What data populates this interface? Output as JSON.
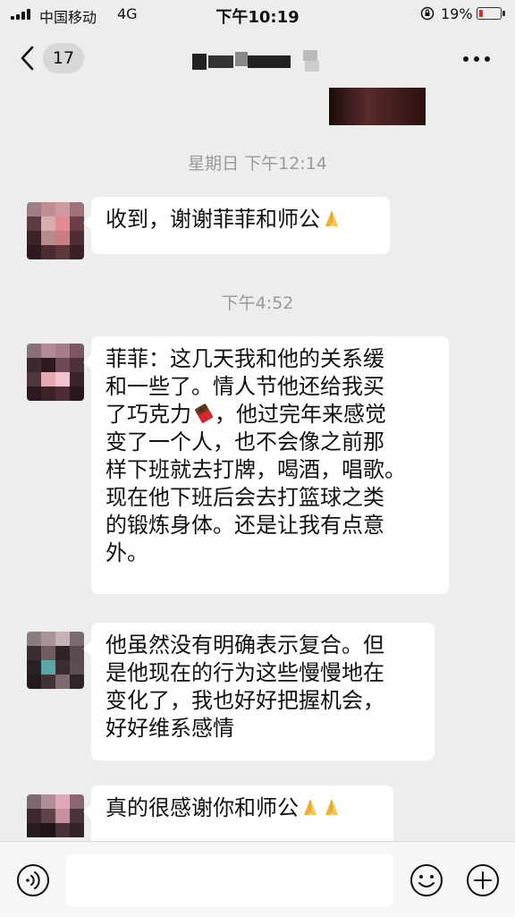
{
  "status_bar": {
    "carrier": "中国移动",
    "network": "4G",
    "time": "下午10:19",
    "battery": "19%",
    "battery_level": 0.19
  },
  "nav": {
    "unread_count": "17"
  },
  "messages": [
    {
      "type": "timestamp",
      "text": "星期日 下午12:14"
    },
    {
      "type": "incoming",
      "lines": [
        "收到，谢谢菲菲和师公"
      ],
      "trailing_emoji": [
        "folded-hands"
      ]
    },
    {
      "type": "timestamp",
      "text": "下午4:52"
    },
    {
      "type": "incoming",
      "lines": [
        "菲菲：这几天我和他的关系缓",
        "和一些了。情人节他还给我买",
        "了巧克力",
        "变了一个人，也不会像之前那",
        "样下班就去打牌，喝酒，唱歌。",
        "现在他下班后会去打篮球之类",
        "的锻炼身体。还是让我有点意",
        "外。"
      ],
      "inline_emoji": "chocolate",
      "line3_tail": "，他过完年来感觉"
    },
    {
      "type": "incoming",
      "lines": [
        "他虽然没有明确表示复合。但",
        "是他现在的行为这些慢慢地在",
        "变化了，我也好好把握机会，",
        "好好维系感情"
      ]
    },
    {
      "type": "incoming",
      "lines": [
        "真的很感谢你和师公"
      ],
      "trailing_emoji": [
        "folded-hands",
        "folded-hands"
      ]
    }
  ],
  "input_bar": {
    "placeholder": ""
  }
}
